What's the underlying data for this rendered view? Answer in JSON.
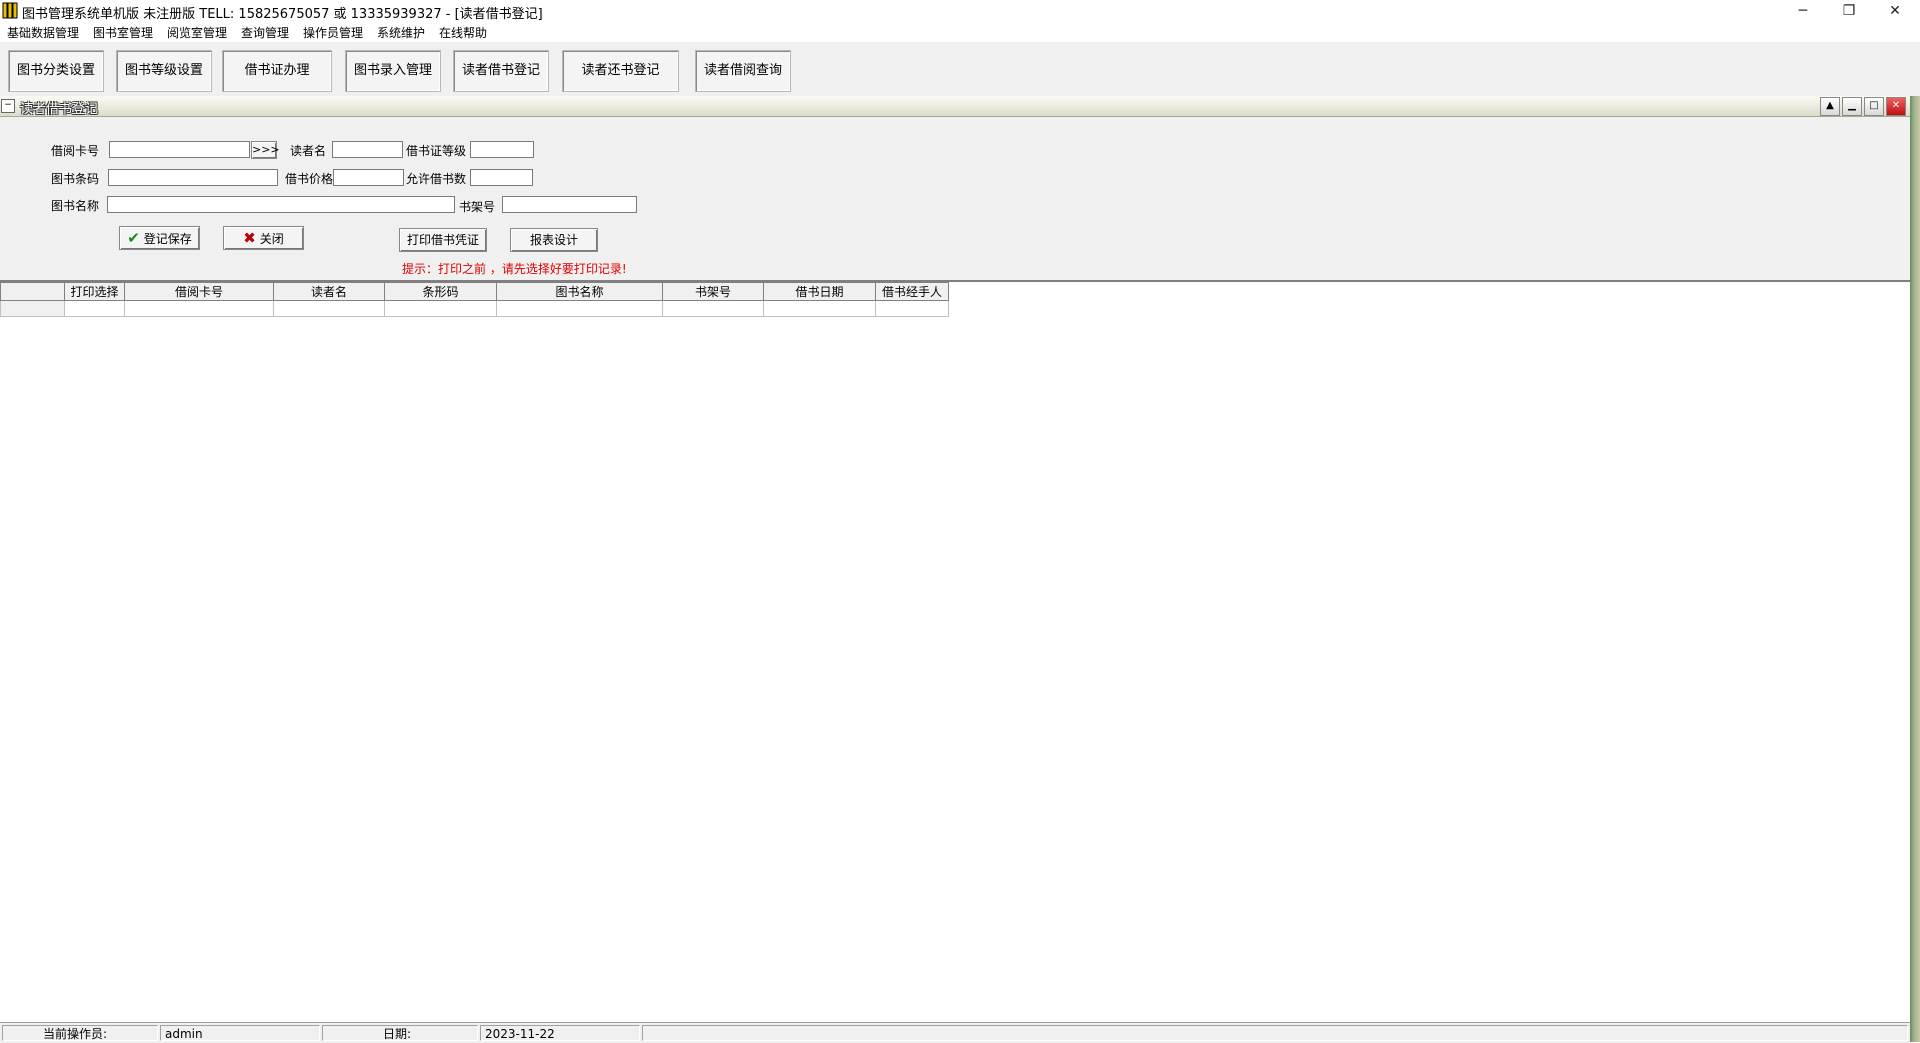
{
  "window": {
    "title": "图书管理系统单机版 未注册版 TELL: 15825675057 或 13335939327 - [读者借书登记]",
    "controls": {
      "minimize": "─",
      "restore": "❐",
      "close": "✕"
    }
  },
  "menu": {
    "items": [
      "基础数据管理",
      "图书室管理",
      "阅览室管理",
      "查询管理",
      "操作员管理",
      "系统维护",
      "在线帮助"
    ]
  },
  "toolbar": {
    "buttons": [
      "图书分类设置",
      "图书等级设置",
      "借书证办理",
      "图书录入管理",
      "读者借书登记",
      "读者还书登记",
      "读者借阅查询"
    ]
  },
  "child_window": {
    "title": "读者借书登记",
    "controls": {
      "collapse": "▲",
      "minimize": "▁",
      "maximize": "□",
      "close": "✕"
    }
  },
  "form": {
    "card_label": "借阅卡号",
    "card_value": "",
    "lookup_button": ">>>",
    "reader_label": "读者名",
    "reader_value": "",
    "level_label": "借书证等级",
    "level_value": "",
    "barcode_label": "图书条码",
    "barcode_value": "",
    "price_label": "借书价格",
    "price_value": "",
    "allowed_label": "允许借书数",
    "allowed_value": "",
    "bookname_label": "图书名称",
    "bookname_value": "",
    "shelf_label": "书架号",
    "shelf_value": "",
    "save_button": "登记保存",
    "close_button": "关闭",
    "print_button": "打印借书凭证",
    "report_button": "报表设计",
    "hint": "提示：打印之前 ，请先选择好要打印记录!"
  },
  "grid": {
    "columns": [
      "打印选择",
      "借阅卡号",
      "读者名",
      "条形码",
      "图书名称",
      "书架号",
      "借书日期",
      "借书经手人"
    ]
  },
  "statusbar": {
    "operator_label": "当前操作员:",
    "operator_value": "admin",
    "date_label": "日期:",
    "date_value": "2023-11-22"
  },
  "colors": {
    "hint": "#e00000",
    "save_check": "#1a8a1a",
    "close_x": "#c00000"
  }
}
